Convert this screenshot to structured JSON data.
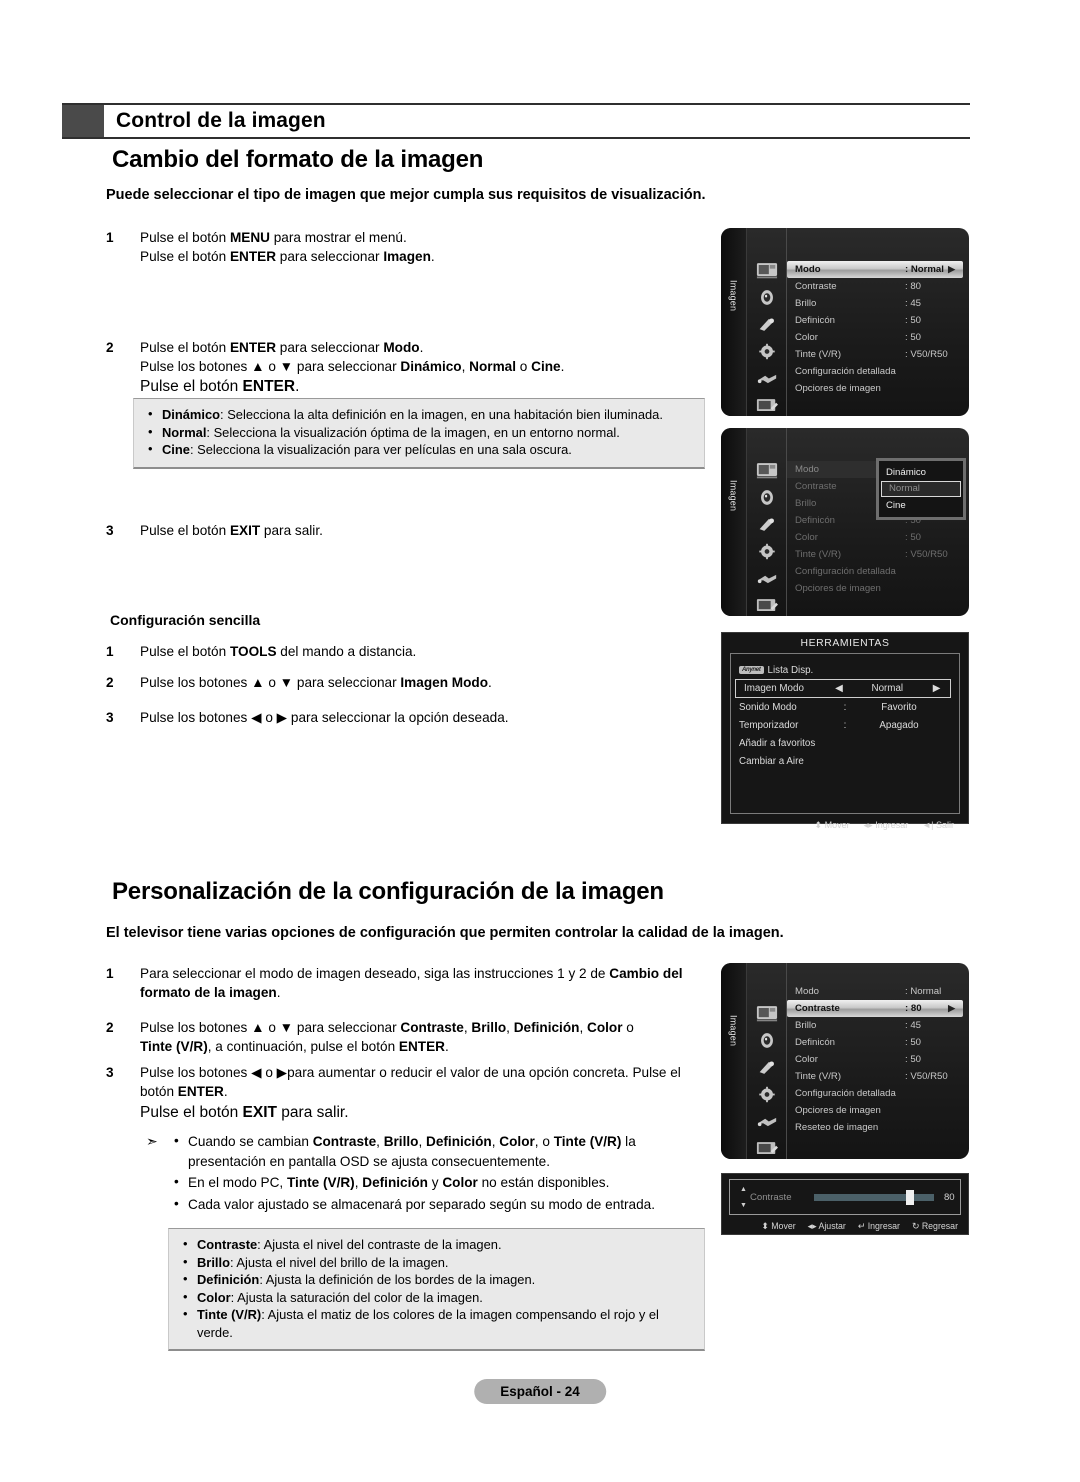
{
  "header": {
    "chapter": "Control de la imagen",
    "section1_title": "Cambio del formato de la imagen",
    "section1_lead": "Puede seleccionar el tipo de imagen que mejor cumpla sus requisitos de visualización.",
    "section2_title": "Personalización de la configuración de la imagen",
    "section2_lead": "El televisor tiene varias opciones de configuración que permiten controlar la calidad de la imagen."
  },
  "steps1": [
    {
      "num": "1",
      "line1_a": "Pulse el botón ",
      "line1_b": "MENU",
      "line1_c": " para mostrar el menú.",
      "line2_a": "Pulse el botón ",
      "line2_b": "ENTER",
      "line2_c": " para seleccionar ",
      "line2_d": "Imagen",
      "line2_e": "."
    },
    {
      "num": "2",
      "line1_a": "Pulse el botón ",
      "line1_b": "ENTER",
      "line1_c": " para seleccionar ",
      "line1_d": "Modo",
      "line1_e": ".",
      "line2_a": "Pulse los botones ▲ o ▼ para seleccionar ",
      "line2_b": "Dinámico",
      "line2_c": ", ",
      "line2_d": "Normal",
      "line2_e": " o ",
      "line2_f": "Cine",
      "line2_g": ".",
      "line3_a": "Pulse el botón ",
      "line3_b": "ENTER",
      "line3_c": "."
    },
    {
      "num": "3",
      "line1_a": "Pulse el botón ",
      "line1_b": "EXIT",
      "line1_c": " para salir."
    }
  ],
  "modes_note": [
    {
      "name": "Dinámico",
      "desc": ": Selecciona la alta definición en la imagen, en una habitación bien iluminada."
    },
    {
      "name": "Normal",
      "desc": ": Selecciona la visualización óptima de la imagen, en un entorno normal."
    },
    {
      "name": "Cine",
      "desc": ": Selecciona la visualización para ver películas en una sala oscura."
    }
  ],
  "easy_setup": {
    "heading": "Configuración sencilla",
    "steps": [
      {
        "num": "1",
        "a": "Pulse el botón ",
        "b": "TOOLS",
        "c": " del mando a distancia."
      },
      {
        "num": "2",
        "a": "Pulse los botones ▲ o ▼ para seleccionar ",
        "b": "Imagen Modo",
        "c": "."
      },
      {
        "num": "3",
        "a": "Pulse los botones ◀ o ▶ para seleccionar la opción deseada.",
        "b": "",
        "c": ""
      }
    ]
  },
  "steps2": {
    "s1_num": "1",
    "s1_a": "Para seleccionar el modo de imagen deseado, siga las instrucciones 1 y 2 de ",
    "s1_b": "Cambio del formato de la imagen",
    "s1_c": ".",
    "s2_num": "2",
    "s2_a": "Pulse los botones ▲ o ▼ para seleccionar ",
    "s2_b": "Contraste",
    "s2_c": ", ",
    "s2_d": "Brillo",
    "s2_e": ", ",
    "s2_f": "Definición",
    "s2_g": ", ",
    "s2_h": "Color",
    "s2_i": " o ",
    "s2_j": "Tinte (V/R)",
    "s2_k": ", a continuación, pulse el botón ",
    "s2_l": "ENTER",
    "s2_m": ".",
    "s3_num": "3",
    "s3_a": "Pulse los botones ◀ o ▶para aumentar o reducir el valor de una opción concreta. Pulse el ",
    "s3_b": "botón ",
    "s3_c": "ENTER",
    "s3_d": ".",
    "exit_a": "Pulse el botón ",
    "exit_b": "EXIT",
    "exit_c": " para salir."
  },
  "notes2": {
    "b1_a": "Cuando se cambian ",
    "b1_b": "Contraste",
    "b1_c": ", ",
    "b1_d": "Brillo",
    "b1_e": ", ",
    "b1_f": "Definición",
    "b1_g": ", ",
    "b1_h": "Color",
    "b1_i": ", o ",
    "b1_j": "Tinte (V/R)",
    "b1_k": " la",
    "b1_l": "presentación en pantalla OSD se ajusta consecuentemente.",
    "b2_a": "En el modo PC, ",
    "b2_b": "Tinte (V/R)",
    "b2_c": ", ",
    "b2_d": "Definición",
    "b2_e": " y ",
    "b2_f": "Color",
    "b2_g": " no están disponibles.",
    "b3": "Cada valor ajustado se almacenará por separado según su modo de entrada."
  },
  "glossary": [
    {
      "term": "Contraste",
      "desc": ": Ajusta el nivel del contraste de la imagen."
    },
    {
      "term": "Brillo",
      "desc": ": Ajusta el nivel del brillo de la imagen."
    },
    {
      "term": "Definición",
      "desc": ": Ajusta la definición de los bordes de la imagen."
    },
    {
      "term": "Color",
      "desc": ": Ajusta la saturación del color de la imagen."
    },
    {
      "term": "Tinte (V/R)",
      "desc": ": Ajusta el matiz de los colores de la imagen compensando el rojo y el verde."
    }
  ],
  "osd": {
    "rail_label": "Imagen",
    "menu1": {
      "rows": [
        {
          "label": "Modo",
          "value": ": Normal",
          "selected": true,
          "caret": "▶"
        },
        {
          "label": "Contraste",
          "value": ": 80"
        },
        {
          "label": "Brillo",
          "value": ": 45"
        },
        {
          "label": "Definicón",
          "value": ": 50"
        },
        {
          "label": "Color",
          "value": ": 50"
        },
        {
          "label": "Tinte (V/R)",
          "value": ": V50/R50"
        },
        {
          "label": "Configuración detallada",
          "value": ""
        },
        {
          "label": "Opciores de imagen",
          "value": ""
        }
      ]
    },
    "menu2": {
      "rows": [
        {
          "label": "Modo",
          "value": ":"
        },
        {
          "label": "Contraste",
          "value": ":"
        },
        {
          "label": "Brillo",
          "value": ":"
        },
        {
          "label": "Definicón",
          "value": ": 50"
        },
        {
          "label": "Color",
          "value": ": 50"
        },
        {
          "label": "Tinte (V/R)",
          "value": ": V50/R50"
        },
        {
          "label": "Configuración detallada",
          "value": ""
        },
        {
          "label": "Opciores de imagen",
          "value": ""
        }
      ],
      "dropdown": [
        {
          "label": "Dinámico",
          "selected": false
        },
        {
          "label": "Normal",
          "selected": true
        },
        {
          "label": "Cine",
          "selected": false
        }
      ]
    },
    "menu3": {
      "rows": [
        {
          "label": "Modo",
          "value": ": Normal"
        },
        {
          "label": "Contraste",
          "value": ": 80",
          "selected": true,
          "caret": "▶"
        },
        {
          "label": "Brillo",
          "value": ": 45"
        },
        {
          "label": "Definicón",
          "value": ": 50"
        },
        {
          "label": "Color",
          "value": ": 50"
        },
        {
          "label": "Tinte (V/R)",
          "value": ": V50/R50"
        },
        {
          "label": "Configuración detallada",
          "value": ""
        },
        {
          "label": "Opciores de imagen",
          "value": ""
        },
        {
          "label": "Reseteo de imagen",
          "value": ""
        }
      ]
    },
    "tools": {
      "title": "HERRAMIENTAS",
      "chip": "Anynet",
      "rows": [
        {
          "t1": "Lista Disp.",
          "t2": "",
          "t3": "",
          "t4": "",
          "chip": true
        },
        {
          "t1": "Imagen Modo",
          "t2": "◀",
          "t3": "Normal",
          "t4": "▶",
          "selected": true
        },
        {
          "t1": "Sonido Modo",
          "t2": ":",
          "t3": "Favorito",
          "t4": ""
        },
        {
          "t1": "Temporizador",
          "t2": ":",
          "t3": "Apagado",
          "t4": ""
        },
        {
          "t1": "Añadir a favoritos",
          "t2": "",
          "t3": "",
          "t4": ""
        },
        {
          "t1": "Cambiar a Aire",
          "t2": "",
          "t3": "",
          "t4": ""
        }
      ],
      "footer": [
        {
          "icon": "⬍",
          "label": "Mover"
        },
        {
          "icon": "◂▸",
          "label": "Ingresar"
        },
        {
          "icon": "◄|",
          "label": "Salir"
        }
      ]
    },
    "slider": {
      "name": "Contraste",
      "value": "80",
      "percent": 80,
      "footer": [
        {
          "icon": "⬍",
          "label": "Mover"
        },
        {
          "icon": "◂▸",
          "label": "Ajustar"
        },
        {
          "icon": "↵",
          "label": "Ingresar"
        },
        {
          "icon": "↻",
          "label": "Regresar"
        }
      ]
    }
  },
  "footer": {
    "page": "Español - 24"
  }
}
